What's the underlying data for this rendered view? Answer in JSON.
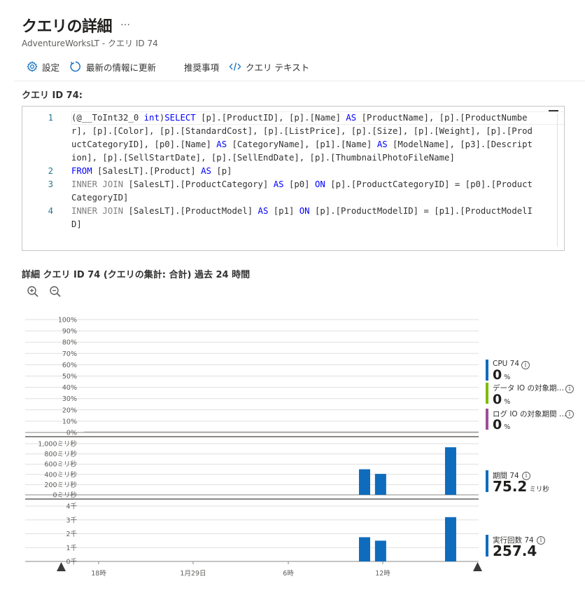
{
  "header": {
    "title": "クエリの詳細",
    "more": "…",
    "subtitle": "AdventureWorksLT - クエリ ID 74"
  },
  "toolbar": {
    "settings": "設定",
    "refresh": "最新の情報に更新",
    "recommendations": "推奨事項",
    "query_text": "クエリ テキスト"
  },
  "query": {
    "label": "クエリ ID 74:",
    "lines": [
      {
        "no": "1",
        "text": "(@__ToInt32_0 int)SELECT [p].[ProductID], [p].[Name] AS [ProductName], [p].[ProductNumber], [p].[Color], [p].[StandardCost], [p].[ListPrice], [p].[Size], [p].[Weight], [p].[ProductCategoryID], [p0].[Name] AS [CategoryName], [p1].[Name] AS [ModelName], [p3].[Description], [p].[SellStartDate], [p].[SellEndDate], [p].[ThumbnailPhotoFileName]"
      },
      {
        "no": "2",
        "text": "FROM [SalesLT].[Product] AS [p]"
      },
      {
        "no": "3",
        "text": "INNER JOIN [SalesLT].[ProductCategory] AS [p0] ON [p].[ProductCategoryID] = [p0].[ProductCategoryID]"
      },
      {
        "no": "4",
        "text": "INNER JOIN [SalesLT].[ProductModel] AS [p1] ON [p].[ProductModelID] = [p1].[ProductModelID]"
      }
    ]
  },
  "details": {
    "heading": "詳細 クエリ ID 74 (クエリの集計: 合計) 過去 24 時間"
  },
  "legend": {
    "cpu": {
      "name": "CPU 74",
      "value": "0",
      "unit": "%",
      "color": "#0f6cbd"
    },
    "data_io": {
      "name": "データ IO の対象期…",
      "value": "0",
      "unit": "%",
      "color": "#7fba00"
    },
    "log_io": {
      "name": "ログ IO の対象期間 …",
      "value": "0",
      "unit": "%",
      "color": "#9c4f96"
    },
    "duration": {
      "name": "期間 74",
      "value": "75.2",
      "unit": "ミリ秒",
      "color": "#0f6cbd"
    },
    "executions": {
      "name": "実行回数 74",
      "value": "257.4",
      "unit": "",
      "color": "#0f6cbd"
    }
  },
  "chart_data": [
    {
      "type": "line",
      "title": "",
      "y_ticks": [
        "100%",
        "90%",
        "80%",
        "70%",
        "60%",
        "50%",
        "40%",
        "30%",
        "20%",
        "10%",
        "0%"
      ],
      "ylim": [
        0,
        100
      ],
      "series": [
        {
          "name": "CPU 74",
          "values": [
            0
          ]
        },
        {
          "name": "データ IO の対象期…",
          "values": [
            0
          ]
        },
        {
          "name": "ログ IO の対象期間 …",
          "values": [
            0
          ]
        }
      ]
    },
    {
      "type": "bar",
      "y_ticks": [
        "1,000ミリ秒",
        "800ミリ秒",
        "600ミリ秒",
        "400ミリ秒",
        "200ミリ秒",
        "0ミリ秒"
      ],
      "ylim": [
        0,
        1000
      ],
      "x_positions": [
        0.715,
        0.755,
        0.93
      ],
      "values": [
        500,
        410,
        930
      ],
      "color": "#0f6cbd"
    },
    {
      "type": "bar",
      "y_ticks": [
        "4千",
        "3千",
        "2千",
        "1千",
        "0千"
      ],
      "ylim": [
        0,
        4000
      ],
      "x_positions": [
        0.715,
        0.755,
        0.93
      ],
      "values": [
        1750,
        1500,
        3200
      ],
      "color": "#0f6cbd",
      "x_ticks": [
        "18時",
        "1月29日",
        "6時",
        "12時"
      ]
    }
  ]
}
